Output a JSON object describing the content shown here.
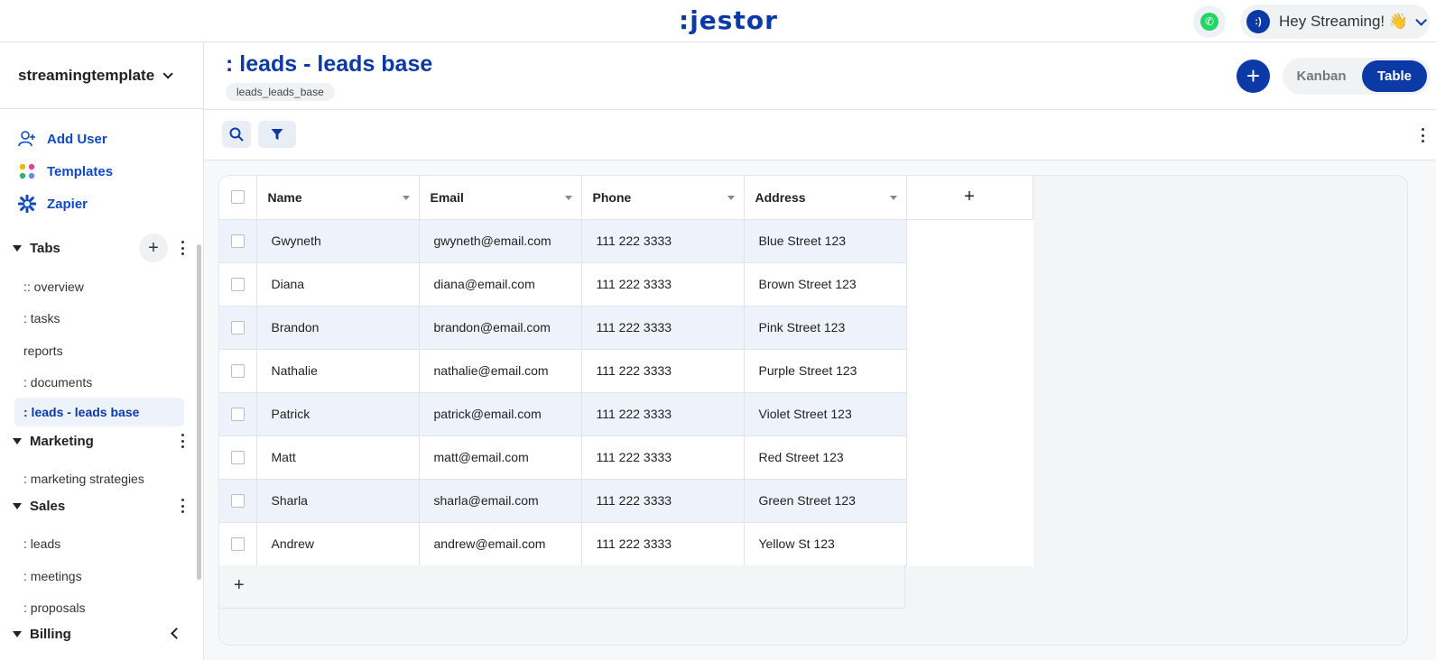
{
  "app": {
    "logo": ":jestor",
    "greeting": "Hey Streaming! 👋",
    "avatar_text": ":)"
  },
  "sidebar": {
    "workspace": "streamingtemplate",
    "quick_links": [
      {
        "label": "Add User",
        "icon": "add-user-icon"
      },
      {
        "label": "Templates",
        "icon": "templates-icon"
      },
      {
        "label": "Zapier",
        "icon": "zapier-icon"
      }
    ],
    "sections": [
      {
        "title": "Tabs",
        "items": [
          ":: overview",
          ": tasks",
          "reports",
          ": documents",
          ": leads - leads base"
        ]
      },
      {
        "title": "Marketing",
        "items": [
          ": marketing strategies"
        ]
      },
      {
        "title": "Sales",
        "items": [
          ": leads",
          ": meetings",
          ": proposals"
        ]
      },
      {
        "title": "Billing",
        "items": []
      }
    ],
    "active_item": ": leads - leads base"
  },
  "header": {
    "title": ": leads - leads base",
    "tag": "leads_leads_base",
    "add_button": "+",
    "views": {
      "kanban": "Kanban",
      "table": "Table",
      "selected": "Table"
    }
  },
  "toolbar": {
    "search_icon": "search-icon",
    "filter_icon": "filter-icon"
  },
  "table": {
    "columns": [
      "Name",
      "Email",
      "Phone",
      "Address"
    ],
    "add_column": "+",
    "add_row": "+",
    "rows": [
      {
        "name": "Gwyneth",
        "email": "gwyneth@email.com",
        "phone": "111 222 3333",
        "address": "Blue Street 123"
      },
      {
        "name": "Diana",
        "email": "diana@email.com",
        "phone": "111 222 3333",
        "address": "Brown Street 123"
      },
      {
        "name": "Brandon",
        "email": "brandon@email.com",
        "phone": "111 222 3333",
        "address": "Pink Street 123"
      },
      {
        "name": "Nathalie",
        "email": "nathalie@email.com",
        "phone": "111 222 3333",
        "address": "Purple Street 123"
      },
      {
        "name": "Patrick",
        "email": "patrick@email.com",
        "phone": "111 222 3333",
        "address": "Violet Street 123"
      },
      {
        "name": "Matt",
        "email": "matt@email.com",
        "phone": "111 222 3333",
        "address": "Red Street 123"
      },
      {
        "name": "Sharla",
        "email": "sharla@email.com",
        "phone": "111 222 3333",
        "address": "Green Street 123"
      },
      {
        "name": "Andrew",
        "email": "andrew@email.com",
        "phone": "111 222 3333",
        "address": "Yellow St 123"
      }
    ]
  },
  "colors": {
    "brand": "#0b3aa6",
    "link": "#1049c4",
    "row_alt": "#eef2fa",
    "whatsapp": "#25d366"
  }
}
